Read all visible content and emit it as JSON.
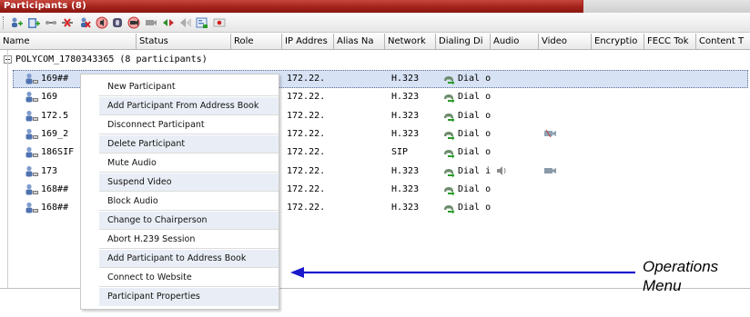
{
  "window": {
    "title": "Participants (8)"
  },
  "toolbar": {
    "buttons": [
      "add-participant-icon",
      "add-from-address-book-icon",
      "connect-icon",
      "disconnect-icon",
      "delete-participant-icon",
      "mute-audio-icon",
      "block-audio-icon",
      "suspend-video-icon",
      "change-layout-icon",
      "abort-h239-icon",
      "send-message-icon",
      "participant-properties-icon",
      "record-icon"
    ]
  },
  "columns": [
    "Name",
    "Status",
    "Role",
    "IP Addres",
    "Alias Na",
    "Network",
    "Dialing Di",
    "Audio",
    "Video",
    "Encryptio",
    "FECC Tok",
    "Content T"
  ],
  "conference": {
    "name": "POLYCOM_1780343365 (8 participants)"
  },
  "participants": [
    {
      "name": "169##",
      "ip": "172.22.",
      "network": "H.323",
      "dialing": "Dial o",
      "audio_icon": "",
      "video_icon": ""
    },
    {
      "name": "169",
      "ip": "172.22.",
      "network": "H.323",
      "dialing": "Dial o",
      "audio_icon": "",
      "video_icon": ""
    },
    {
      "name": "172.5",
      "ip": "172.22.",
      "network": "H.323",
      "dialing": "Dial o",
      "audio_icon": "",
      "video_icon": ""
    },
    {
      "name": "169_2",
      "ip": "172.22.",
      "network": "H.323",
      "dialing": "Dial o",
      "audio_icon": "",
      "video_icon": "video-suspended-icon"
    },
    {
      "name": "186SIF",
      "ip": "172.22.",
      "network": "SIP",
      "dialing": "Dial o",
      "audio_icon": "",
      "video_icon": ""
    },
    {
      "name": "173",
      "ip": "172.22.",
      "network": "H.323",
      "dialing": "Dial i",
      "audio_icon": "speaker-icon",
      "video_icon": "video-camera-icon"
    },
    {
      "name": "168##",
      "ip": "172.22.",
      "network": "H.323",
      "dialing": "Dial o",
      "audio_icon": "",
      "video_icon": ""
    },
    {
      "name": "168##",
      "ip": "172.22.",
      "network": "H.323",
      "dialing": "Dial o",
      "audio_icon": "",
      "video_icon": ""
    }
  ],
  "context_menu": {
    "items": [
      "New Participant",
      "Add Participant From Address Book",
      "Disconnect Participant",
      "Delete Participant",
      "Mute Audio",
      "Suspend Video",
      "Block Audio",
      "Change to Chairperson",
      "Abort H.239 Session",
      "Add Participant to Address Book",
      "Connect to Website",
      "Participant Properties"
    ]
  },
  "annotation": {
    "label_line1": "Operations",
    "label_line2": "Menu",
    "color": "#1a1acc"
  },
  "colors": {
    "title_bar": "#a3231c",
    "selection": "#d7e2f4"
  }
}
